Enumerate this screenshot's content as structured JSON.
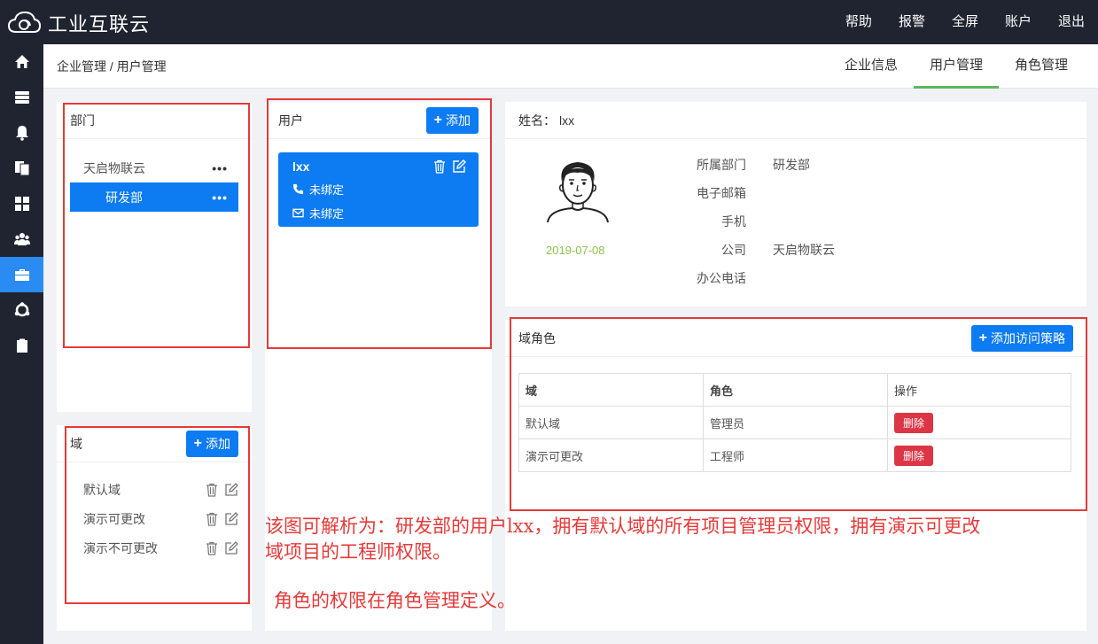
{
  "app": {
    "title": "工业互联云"
  },
  "topnav": [
    "帮助",
    "报警",
    "全屏",
    "账户",
    "退出"
  ],
  "breadcrumb": "企业管理 / 用户管理",
  "tabs": [
    {
      "label": "企业信息",
      "active": false
    },
    {
      "label": "用户管理",
      "active": true
    },
    {
      "label": "角色管理",
      "active": false
    }
  ],
  "dept": {
    "title": "部门",
    "items": [
      {
        "label": "天启物联云",
        "menu": "•••"
      },
      {
        "label": "研发部",
        "menu": "•••"
      }
    ]
  },
  "domain": {
    "title": "域",
    "add_label": "添加",
    "items": [
      "默认域",
      "演示可更改",
      "演示不可更改"
    ]
  },
  "users": {
    "title": "用户",
    "add_label": "添加",
    "card": {
      "name": "lxx",
      "phone": "未绑定",
      "email": "未绑定"
    }
  },
  "profile": {
    "name_label": "姓名：",
    "name": "lxx",
    "date": "2019-07-08",
    "fields": [
      {
        "label": "所属部门",
        "value": "研发部"
      },
      {
        "label": "电子邮箱",
        "value": ""
      },
      {
        "label": "手机",
        "value": ""
      },
      {
        "label": "公司",
        "value": "天启物联云"
      },
      {
        "label": "办公电话",
        "value": ""
      }
    ]
  },
  "roles": {
    "title": "域角色",
    "add_label": "添加访问策略",
    "columns": [
      "域",
      "角色",
      "操作"
    ],
    "rows": [
      {
        "domain": "默认域",
        "role": "管理员",
        "action": "删除"
      },
      {
        "domain": "演示可更改",
        "role": "工程师",
        "action": "删除"
      }
    ]
  },
  "annotations": {
    "line1": "该图可解析为：研发部的用户lxx，拥有默认域的所有项目管理员权限，拥有演示可更改",
    "line2": "域项目的工程师权限。",
    "line3": "角色的权限在角色管理定义。"
  },
  "colors": {
    "primary": "#0d7bf2",
    "danger": "#dc3545",
    "nav_bg": "#1f2430",
    "annotation": "#e63939",
    "date": "#8bc34a",
    "tab_underline": "#5cb85c"
  }
}
